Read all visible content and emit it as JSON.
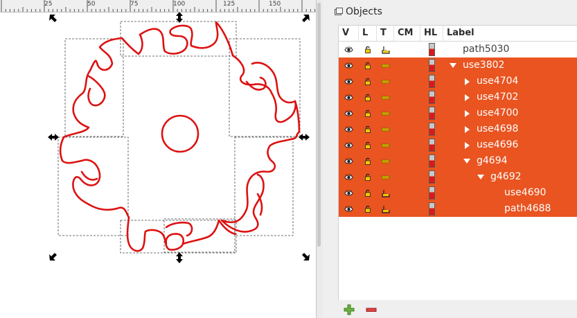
{
  "ruler": {
    "labels": [
      "25",
      "50",
      "75",
      "100",
      "125",
      "150"
    ]
  },
  "panel": {
    "title": "Objects",
    "columns": {
      "v": "V",
      "l": "L",
      "t": "T",
      "cm": "CM",
      "hl": "HL",
      "label": "Label"
    }
  },
  "tree": {
    "rows": [
      {
        "label": "path5030",
        "depth": 0,
        "arrow": "none",
        "type": "path",
        "selected": false
      },
      {
        "label": "use3802",
        "depth": 0,
        "arrow": "down",
        "type": "clone",
        "selected": true
      },
      {
        "label": "use4704",
        "depth": 1,
        "arrow": "right",
        "type": "clone",
        "selected": true
      },
      {
        "label": "use4702",
        "depth": 1,
        "arrow": "right",
        "type": "clone",
        "selected": true
      },
      {
        "label": "use4700",
        "depth": 1,
        "arrow": "right",
        "type": "clone",
        "selected": true
      },
      {
        "label": "use4698",
        "depth": 1,
        "arrow": "right",
        "type": "clone",
        "selected": true
      },
      {
        "label": "use4696",
        "depth": 1,
        "arrow": "right",
        "type": "clone",
        "selected": true
      },
      {
        "label": "g4694",
        "depth": 1,
        "arrow": "down",
        "type": "clone",
        "selected": true
      },
      {
        "label": "g4692",
        "depth": 2,
        "arrow": "down",
        "type": "clone",
        "selected": true
      },
      {
        "label": "use4690",
        "depth": 3,
        "arrow": "none",
        "type": "path",
        "selected": true
      },
      {
        "label": "path4688",
        "depth": 3,
        "arrow": "none",
        "type": "path",
        "selected": true
      }
    ]
  },
  "colors": {
    "selection": "#e95420",
    "stroke": "#dd1111"
  },
  "icons": {
    "panel": "objects-panel-icon",
    "visible": "eye-icon",
    "lock": "unlocked-icon",
    "type_path": "path-tool-icon",
    "type_clone": "clone-icon",
    "add": "add-plus-icon",
    "remove": "remove-minus-icon"
  }
}
